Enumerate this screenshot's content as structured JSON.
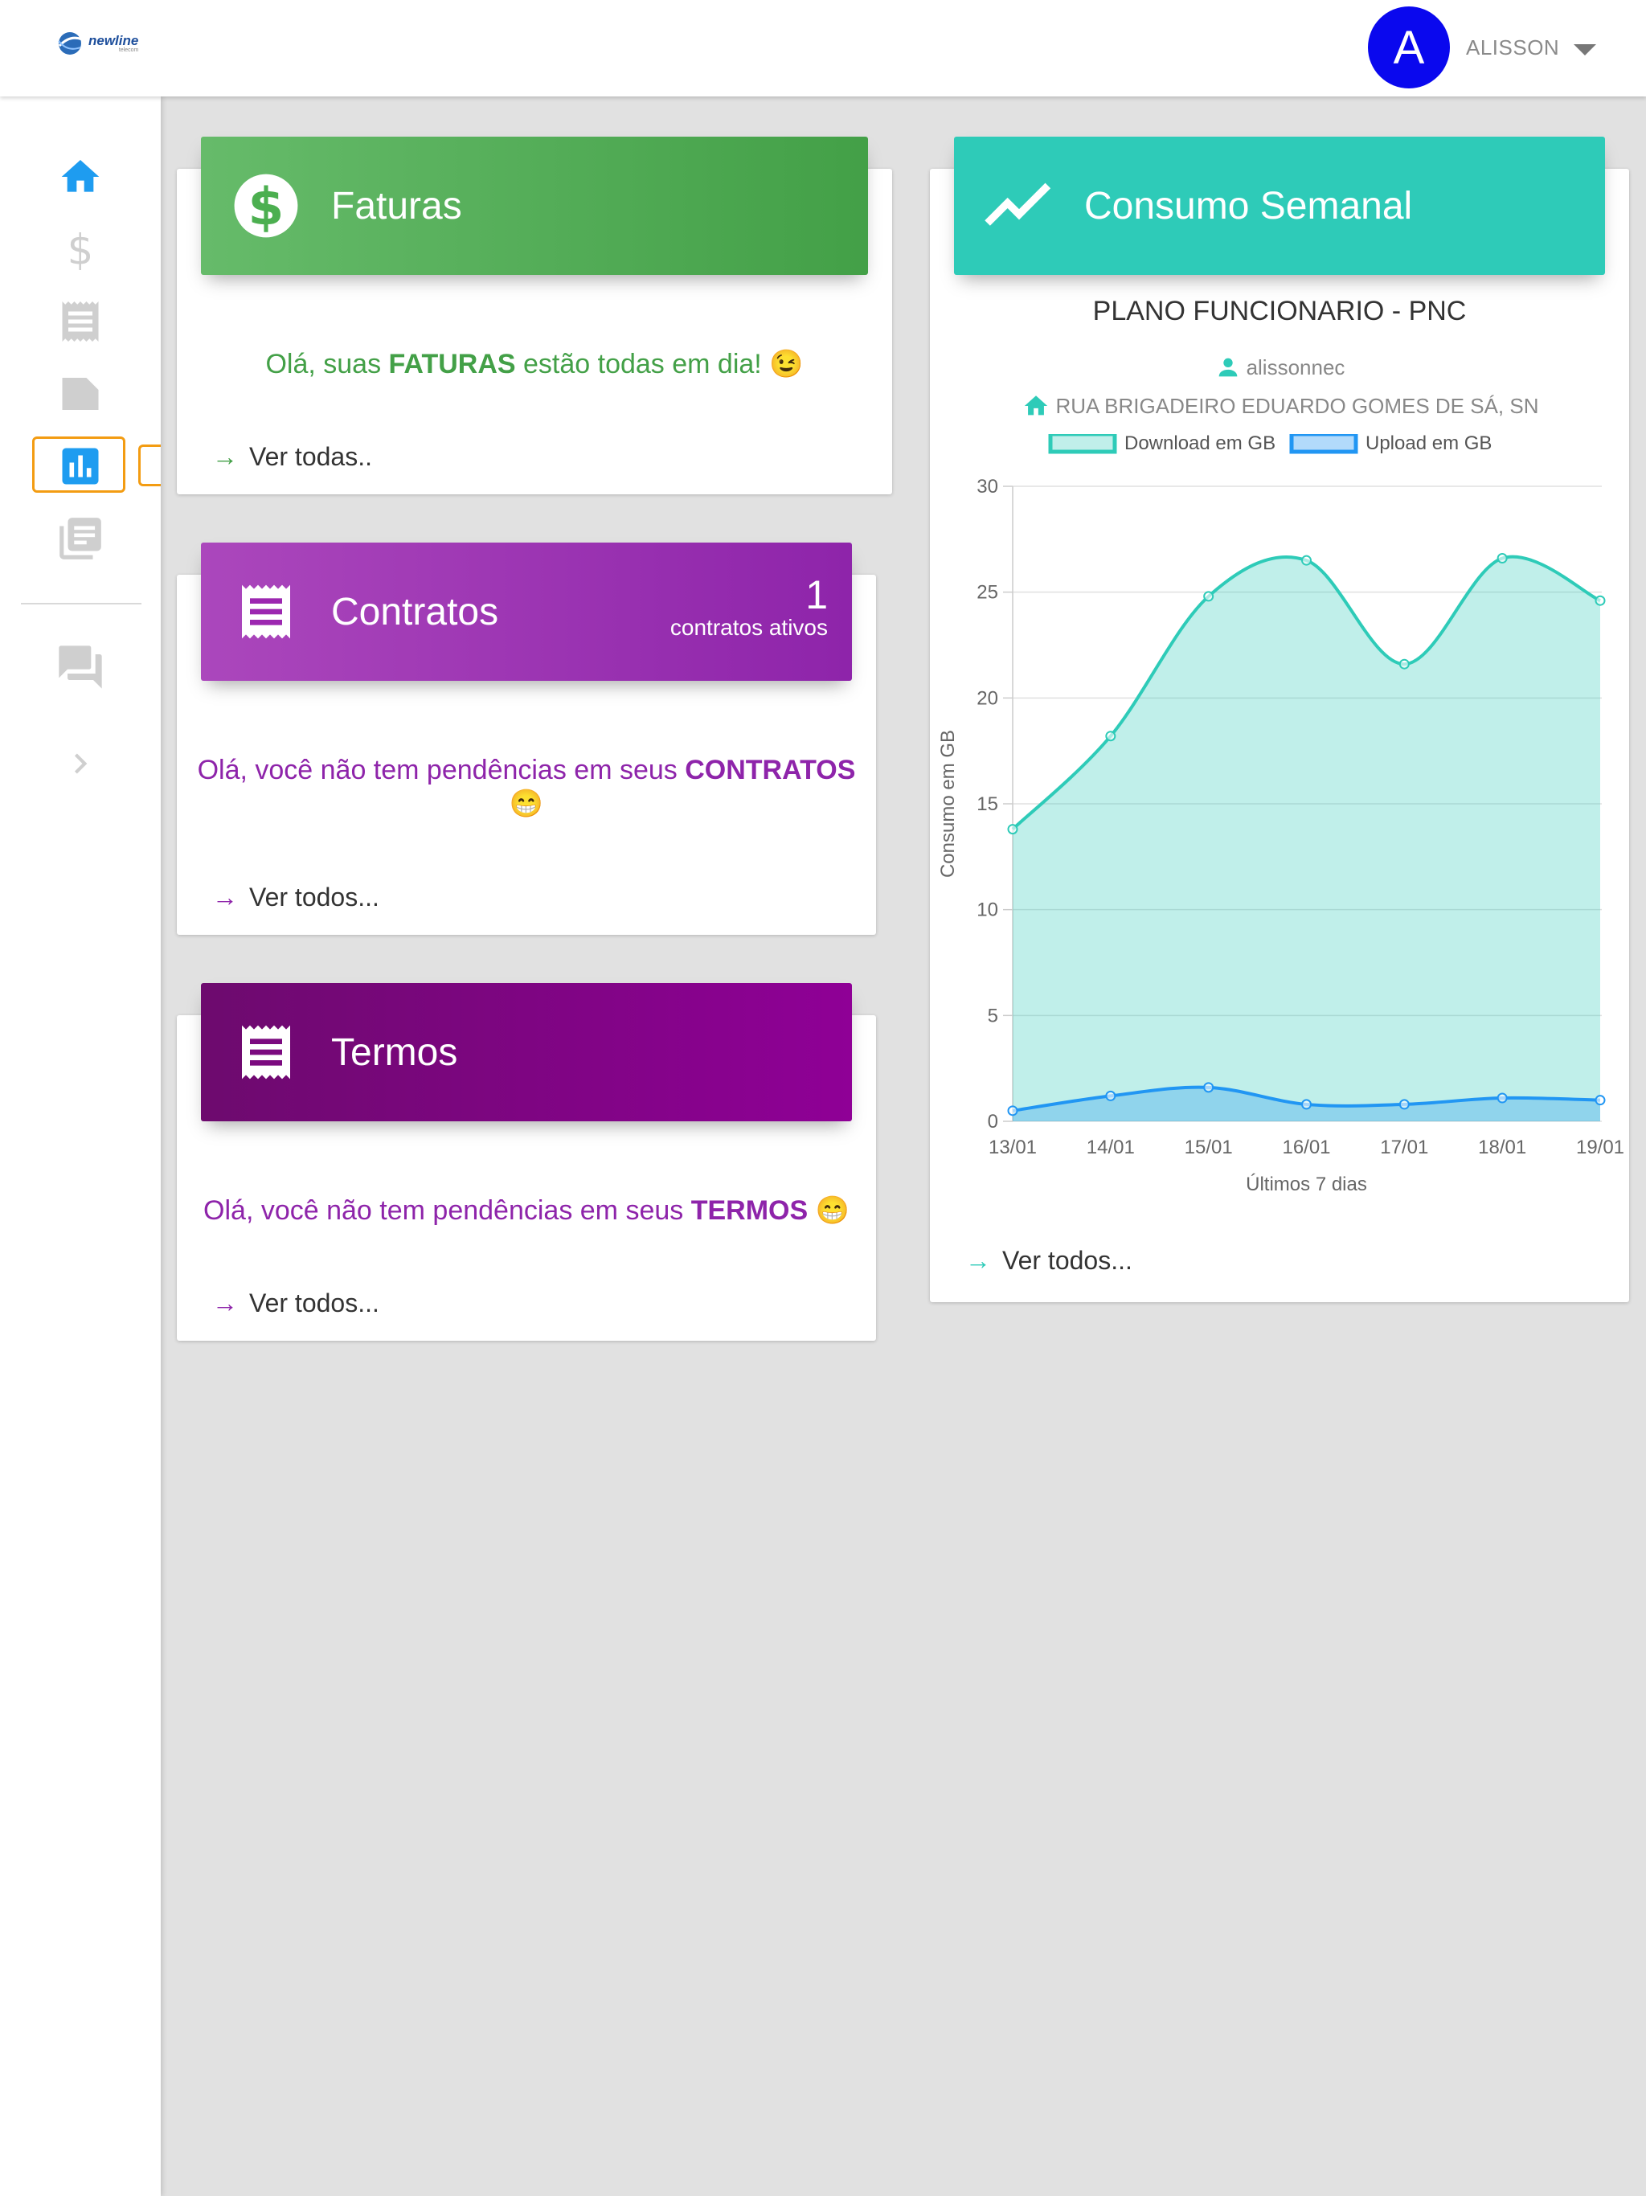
{
  "header": {
    "logo_text": "newline",
    "logo_sub": "telecom",
    "avatar_letter": "A",
    "username": "ALISSON"
  },
  "sidebar": {
    "items": [
      {
        "icon": "home-icon",
        "active": false
      },
      {
        "icon": "dollar-icon",
        "active": false
      },
      {
        "icon": "receipt-icon",
        "active": false
      },
      {
        "icon": "note-icon",
        "active": false
      },
      {
        "icon": "bar-chart-icon",
        "active": true
      },
      {
        "icon": "library-icon",
        "active": false
      },
      {
        "icon": "chat-icon",
        "active": false
      },
      {
        "icon": "chevron-right-icon",
        "active": false
      }
    ]
  },
  "faturas": {
    "title": "Faturas",
    "msg_prefix": "Olá, suas ",
    "msg_strong": "FATURAS",
    "msg_suffix": " estão todas em dia! 😉",
    "link": "Ver todas..",
    "color": "#43a047"
  },
  "contratos": {
    "title": "Contratos",
    "count": "1",
    "count_label": "contratos ativos",
    "msg_prefix": "Olá, você não tem pendências em seus ",
    "msg_strong": "CONTRATOS",
    "msg_emoji": "😁",
    "link": "Ver todos...",
    "color": "#8e24aa"
  },
  "termos": {
    "title": "Termos",
    "msg_prefix": "Olá, você não tem pendências em seus ",
    "msg_strong": "TERMOS",
    "msg_suffix": " 😁",
    "link": "Ver todos...",
    "color": "#8e24aa"
  },
  "consumo": {
    "title": "Consumo Semanal",
    "plan": "PLANO FUNCIONARIO - PNC",
    "user": "alissonnec",
    "address": "RUA BRIGADEIRO EDUARDO GOMES DE SÁ, SN",
    "link": "Ver todos...",
    "color": "#2ecbb8"
  },
  "chart_data": {
    "type": "area",
    "categories": [
      "13/01",
      "14/01",
      "15/01",
      "16/01",
      "17/01",
      "18/01",
      "19/01"
    ],
    "series": [
      {
        "name": "Download em GB",
        "values": [
          13.8,
          18.2,
          24.8,
          26.5,
          21.6,
          26.6,
          24.6
        ],
        "color": "#2ecbb8"
      },
      {
        "name": "Upload em GB",
        "values": [
          0.5,
          1.2,
          1.6,
          0.8,
          0.8,
          1.1,
          1.0
        ],
        "color": "#2196f3"
      }
    ],
    "xlabel": "Últimos 7 dias",
    "ylabel": "Consumo em GB",
    "ylim": [
      0,
      30
    ],
    "yticks": [
      "0",
      "5",
      "10",
      "15",
      "20",
      "25",
      "30"
    ],
    "grid": true,
    "legend": "top"
  }
}
